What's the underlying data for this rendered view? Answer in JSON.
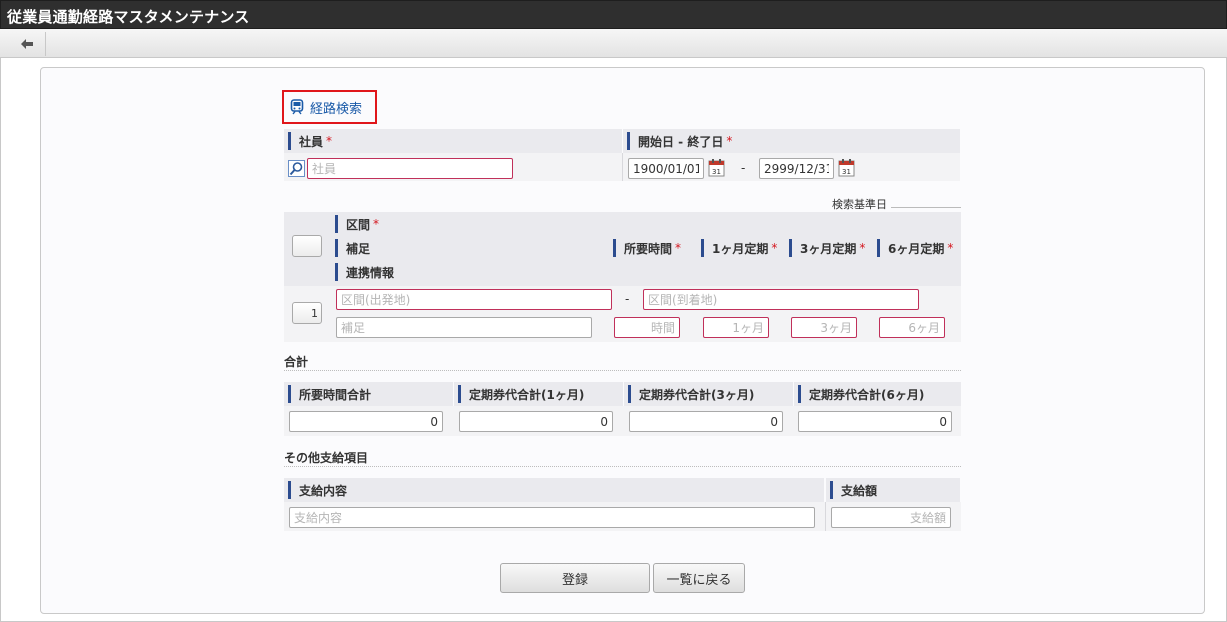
{
  "window": {
    "title": "従業員通勤経路マスタメンテナンス"
  },
  "toolbar": {
    "back_icon": "arrow-left-icon"
  },
  "route_search": {
    "label": "経路検索",
    "icon": "train-icon",
    "highlight_color": "#e0161b"
  },
  "employee": {
    "label": "社員",
    "required_mark": "*",
    "placeholder": "社員",
    "value": ""
  },
  "period": {
    "label": "開始日 - 終了日",
    "required_mark": "*",
    "start": "1900/01/01",
    "separator": "-",
    "end": "2999/12/31",
    "base_date_label": "検索基準日"
  },
  "segments": {
    "headers": {
      "section": "区間",
      "note": "補足",
      "duration": "所要時間",
      "pass1": "1ヶ月定期",
      "pass3": "3ヶ月定期",
      "pass6": "6ヶ月定期",
      "link": "連携情報"
    },
    "required_mark": "*",
    "rows": [
      {
        "index": "1",
        "from_placeholder": "区間(出発地)",
        "separator": "-",
        "to_placeholder": "区間(到着地)",
        "note_placeholder": "補足",
        "duration_placeholder": "時間",
        "pass1_placeholder": "1ヶ月",
        "pass3_placeholder": "3ヶ月",
        "pass6_placeholder": "6ヶ月"
      }
    ]
  },
  "totals": {
    "section_title": "合計",
    "columns": [
      {
        "label": "所要時間合計",
        "value": "0"
      },
      {
        "label": "定期券代合計(1ヶ月)",
        "value": "0"
      },
      {
        "label": "定期券代合計(3ヶ月)",
        "value": "0"
      },
      {
        "label": "定期券代合計(6ヶ月)",
        "value": "0"
      }
    ]
  },
  "other_pay": {
    "section_title": "その他支給項目",
    "content_label": "支給内容",
    "content_placeholder": "支給内容",
    "amount_label": "支給額",
    "amount_placeholder": "支給額"
  },
  "actions": {
    "register": "登録",
    "back_to_list": "一覧に戻る"
  },
  "colors": {
    "accent_bar": "#2c4c8f",
    "required": "#d4161e",
    "titlebar": "#2f2f2f"
  }
}
